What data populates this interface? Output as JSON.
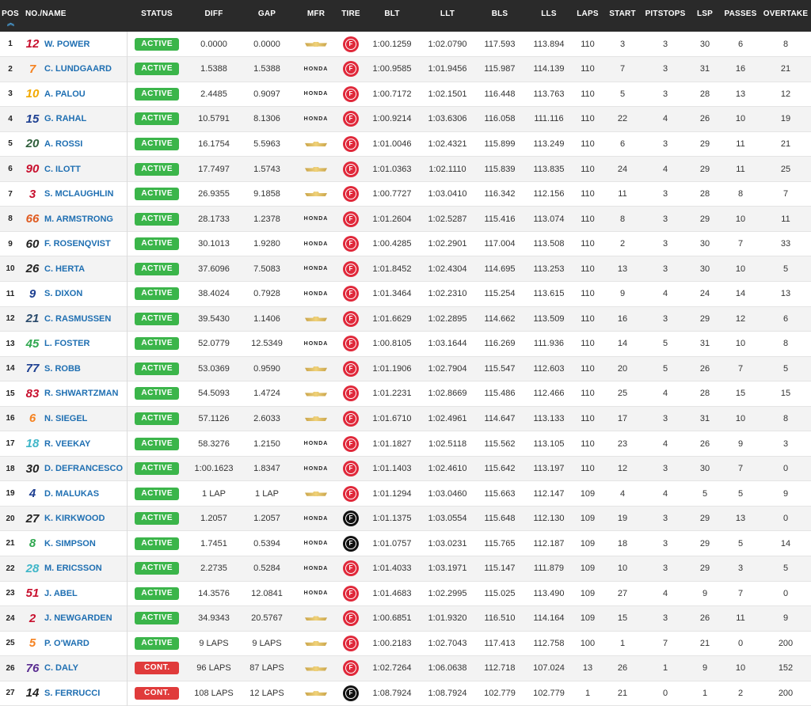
{
  "headers": {
    "pos": "POS",
    "name": "NO./NAME",
    "status": "STATUS",
    "diff": "DIFF",
    "gap": "GAP",
    "mfr": "MFR",
    "tire": "TIRE",
    "blt": "BLT",
    "llt": "LLT",
    "bls": "BLS",
    "lls": "LLS",
    "laps": "LAPS",
    "start": "START",
    "pitstops": "PITSTOPS",
    "lsp": "LSP",
    "passes": "PASSES",
    "overtake": "OVERTAKE"
  },
  "honda_label": "HONDA",
  "rows": [
    {
      "pos": "1",
      "num": "12",
      "num_color": "#c8102e",
      "name": "W. POWER",
      "status": "ACTIVE",
      "diff": "0.0000",
      "gap": "0.0000",
      "mfr": "chevrolet",
      "tire": "red",
      "blt": "1:00.1259",
      "llt": "1:02.0790",
      "bls": "117.593",
      "lls": "113.894",
      "laps": "110",
      "start": "3",
      "pitstops": "3",
      "lsp": "30",
      "passes": "6",
      "overtake": "8"
    },
    {
      "pos": "2",
      "num": "7",
      "num_color": "#f58220",
      "name": "C. LUNDGAARD",
      "status": "ACTIVE",
      "diff": "1.5388",
      "gap": "1.5388",
      "mfr": "honda",
      "tire": "red",
      "blt": "1:00.9585",
      "llt": "1:01.9456",
      "bls": "115.987",
      "lls": "114.139",
      "laps": "110",
      "start": "7",
      "pitstops": "3",
      "lsp": "31",
      "passes": "16",
      "overtake": "21"
    },
    {
      "pos": "3",
      "num": "10",
      "num_color": "#f2a900",
      "name": "A. PALOU",
      "status": "ACTIVE",
      "diff": "2.4485",
      "gap": "0.9097",
      "mfr": "honda",
      "tire": "red",
      "blt": "1:00.7172",
      "llt": "1:02.1501",
      "bls": "116.448",
      "lls": "113.763",
      "laps": "110",
      "start": "5",
      "pitstops": "3",
      "lsp": "28",
      "passes": "13",
      "overtake": "12"
    },
    {
      "pos": "4",
      "num": "15",
      "num_color": "#1d3f91",
      "name": "G. RAHAL",
      "status": "ACTIVE",
      "diff": "10.5791",
      "gap": "8.1306",
      "mfr": "honda",
      "tire": "red",
      "blt": "1:00.9214",
      "llt": "1:03.6306",
      "bls": "116.058",
      "lls": "111.116",
      "laps": "110",
      "start": "22",
      "pitstops": "4",
      "lsp": "26",
      "passes": "10",
      "overtake": "19"
    },
    {
      "pos": "5",
      "num": "20",
      "num_color": "#2e5e3a",
      "name": "A. ROSSI",
      "status": "ACTIVE",
      "diff": "16.1754",
      "gap": "5.5963",
      "mfr": "chevrolet",
      "tire": "red",
      "blt": "1:01.0046",
      "llt": "1:02.4321",
      "bls": "115.899",
      "lls": "113.249",
      "laps": "110",
      "start": "6",
      "pitstops": "3",
      "lsp": "29",
      "passes": "11",
      "overtake": "21"
    },
    {
      "pos": "6",
      "num": "90",
      "num_color": "#c8102e",
      "name": "C. ILOTT",
      "status": "ACTIVE",
      "diff": "17.7497",
      "gap": "1.5743",
      "mfr": "chevrolet",
      "tire": "red",
      "blt": "1:01.0363",
      "llt": "1:02.1110",
      "bls": "115.839",
      "lls": "113.835",
      "laps": "110",
      "start": "24",
      "pitstops": "4",
      "lsp": "29",
      "passes": "11",
      "overtake": "25"
    },
    {
      "pos": "7",
      "num": "3",
      "num_color": "#c8102e",
      "name": "S. MCLAUGHLIN",
      "status": "ACTIVE",
      "diff": "26.9355",
      "gap": "9.1858",
      "mfr": "chevrolet",
      "tire": "red",
      "blt": "1:00.7727",
      "llt": "1:03.0410",
      "bls": "116.342",
      "lls": "112.156",
      "laps": "110",
      "start": "11",
      "pitstops": "3",
      "lsp": "28",
      "passes": "8",
      "overtake": "7"
    },
    {
      "pos": "8",
      "num": "66",
      "num_color": "#e05a1f",
      "name": "M. ARMSTRONG",
      "status": "ACTIVE",
      "diff": "28.1733",
      "gap": "1.2378",
      "mfr": "honda",
      "tire": "red",
      "blt": "1:01.2604",
      "llt": "1:02.5287",
      "bls": "115.416",
      "lls": "113.074",
      "laps": "110",
      "start": "8",
      "pitstops": "3",
      "lsp": "29",
      "passes": "10",
      "overtake": "11"
    },
    {
      "pos": "9",
      "num": "60",
      "num_color": "#222222",
      "name": "F. ROSENQVIST",
      "status": "ACTIVE",
      "diff": "30.1013",
      "gap": "1.9280",
      "mfr": "honda",
      "tire": "red",
      "blt": "1:00.4285",
      "llt": "1:02.2901",
      "bls": "117.004",
      "lls": "113.508",
      "laps": "110",
      "start": "2",
      "pitstops": "3",
      "lsp": "30",
      "passes": "7",
      "overtake": "33"
    },
    {
      "pos": "10",
      "num": "26",
      "num_color": "#222222",
      "name": "C. HERTA",
      "status": "ACTIVE",
      "diff": "37.6096",
      "gap": "7.5083",
      "mfr": "honda",
      "tire": "red",
      "blt": "1:01.8452",
      "llt": "1:02.4304",
      "bls": "114.695",
      "lls": "113.253",
      "laps": "110",
      "start": "13",
      "pitstops": "3",
      "lsp": "30",
      "passes": "10",
      "overtake": "5"
    },
    {
      "pos": "11",
      "num": "9",
      "num_color": "#1d3f91",
      "name": "S. DIXON",
      "status": "ACTIVE",
      "diff": "38.4024",
      "gap": "0.7928",
      "mfr": "honda",
      "tire": "red",
      "blt": "1:01.3464",
      "llt": "1:02.2310",
      "bls": "115.254",
      "lls": "113.615",
      "laps": "110",
      "start": "9",
      "pitstops": "4",
      "lsp": "24",
      "passes": "14",
      "overtake": "13"
    },
    {
      "pos": "12",
      "num": "21",
      "num_color": "#2a4a6b",
      "name": "C. RASMUSSEN",
      "status": "ACTIVE",
      "diff": "39.5430",
      "gap": "1.1406",
      "mfr": "chevrolet",
      "tire": "red",
      "blt": "1:01.6629",
      "llt": "1:02.2895",
      "bls": "114.662",
      "lls": "113.509",
      "laps": "110",
      "start": "16",
      "pitstops": "3",
      "lsp": "29",
      "passes": "12",
      "overtake": "6"
    },
    {
      "pos": "13",
      "num": "45",
      "num_color": "#2fa84f",
      "name": "L. FOSTER",
      "status": "ACTIVE",
      "diff": "52.0779",
      "gap": "12.5349",
      "mfr": "honda",
      "tire": "red",
      "blt": "1:00.8105",
      "llt": "1:03.1644",
      "bls": "116.269",
      "lls": "111.936",
      "laps": "110",
      "start": "14",
      "pitstops": "5",
      "lsp": "31",
      "passes": "10",
      "overtake": "8"
    },
    {
      "pos": "14",
      "num": "77",
      "num_color": "#1d3f91",
      "name": "S. ROBB",
      "status": "ACTIVE",
      "diff": "53.0369",
      "gap": "0.9590",
      "mfr": "chevrolet",
      "tire": "red",
      "blt": "1:01.1906",
      "llt": "1:02.7904",
      "bls": "115.547",
      "lls": "112.603",
      "laps": "110",
      "start": "20",
      "pitstops": "5",
      "lsp": "26",
      "passes": "7",
      "overtake": "5"
    },
    {
      "pos": "15",
      "num": "83",
      "num_color": "#c8102e",
      "name": "R. SHWARTZMAN",
      "status": "ACTIVE",
      "diff": "54.5093",
      "gap": "1.4724",
      "mfr": "chevrolet",
      "tire": "red",
      "blt": "1:01.2231",
      "llt": "1:02.8669",
      "bls": "115.486",
      "lls": "112.466",
      "laps": "110",
      "start": "25",
      "pitstops": "4",
      "lsp": "28",
      "passes": "15",
      "overtake": "15"
    },
    {
      "pos": "16",
      "num": "6",
      "num_color": "#f58220",
      "name": "N. SIEGEL",
      "status": "ACTIVE",
      "diff": "57.1126",
      "gap": "2.6033",
      "mfr": "chevrolet",
      "tire": "red",
      "blt": "1:01.6710",
      "llt": "1:02.4961",
      "bls": "114.647",
      "lls": "113.133",
      "laps": "110",
      "start": "17",
      "pitstops": "3",
      "lsp": "31",
      "passes": "10",
      "overtake": "8"
    },
    {
      "pos": "17",
      "num": "18",
      "num_color": "#3fb6c8",
      "name": "R. VEEKAY",
      "status": "ACTIVE",
      "diff": "58.3276",
      "gap": "1.2150",
      "mfr": "honda",
      "tire": "red",
      "blt": "1:01.1827",
      "llt": "1:02.5118",
      "bls": "115.562",
      "lls": "113.105",
      "laps": "110",
      "start": "23",
      "pitstops": "4",
      "lsp": "26",
      "passes": "9",
      "overtake": "3"
    },
    {
      "pos": "18",
      "num": "30",
      "num_color": "#222222",
      "name": "D. DEFRANCESCO",
      "status": "ACTIVE",
      "diff": "1:00.1623",
      "gap": "1.8347",
      "mfr": "honda",
      "tire": "red",
      "blt": "1:01.1403",
      "llt": "1:02.4610",
      "bls": "115.642",
      "lls": "113.197",
      "laps": "110",
      "start": "12",
      "pitstops": "3",
      "lsp": "30",
      "passes": "7",
      "overtake": "0"
    },
    {
      "pos": "19",
      "num": "4",
      "num_color": "#1d3f91",
      "name": "D. MALUKAS",
      "status": "ACTIVE",
      "diff": "1 LAP",
      "gap": "1 LAP",
      "mfr": "chevrolet",
      "tire": "red",
      "blt": "1:01.1294",
      "llt": "1:03.0460",
      "bls": "115.663",
      "lls": "112.147",
      "laps": "109",
      "start": "4",
      "pitstops": "4",
      "lsp": "5",
      "passes": "5",
      "overtake": "9"
    },
    {
      "pos": "20",
      "num": "27",
      "num_color": "#222222",
      "name": "K. KIRKWOOD",
      "status": "ACTIVE",
      "diff": "1.2057",
      "gap": "1.2057",
      "mfr": "honda",
      "tire": "black",
      "blt": "1:01.1375",
      "llt": "1:03.0554",
      "bls": "115.648",
      "lls": "112.130",
      "laps": "109",
      "start": "19",
      "pitstops": "3",
      "lsp": "29",
      "passes": "13",
      "overtake": "0"
    },
    {
      "pos": "21",
      "num": "8",
      "num_color": "#2fa84f",
      "name": "K. SIMPSON",
      "status": "ACTIVE",
      "diff": "1.7451",
      "gap": "0.5394",
      "mfr": "honda",
      "tire": "black",
      "blt": "1:01.0757",
      "llt": "1:03.0231",
      "bls": "115.765",
      "lls": "112.187",
      "laps": "109",
      "start": "18",
      "pitstops": "3",
      "lsp": "29",
      "passes": "5",
      "overtake": "14"
    },
    {
      "pos": "22",
      "num": "28",
      "num_color": "#3fb6c8",
      "name": "M. ERICSSON",
      "status": "ACTIVE",
      "diff": "2.2735",
      "gap": "0.5284",
      "mfr": "honda",
      "tire": "red",
      "blt": "1:01.4033",
      "llt": "1:03.1971",
      "bls": "115.147",
      "lls": "111.879",
      "laps": "109",
      "start": "10",
      "pitstops": "3",
      "lsp": "29",
      "passes": "3",
      "overtake": "5"
    },
    {
      "pos": "23",
      "num": "51",
      "num_color": "#c8102e",
      "name": "J. ABEL",
      "status": "ACTIVE",
      "diff": "14.3576",
      "gap": "12.0841",
      "mfr": "honda",
      "tire": "red",
      "blt": "1:01.4683",
      "llt": "1:02.2995",
      "bls": "115.025",
      "lls": "113.490",
      "laps": "109",
      "start": "27",
      "pitstops": "4",
      "lsp": "9",
      "passes": "7",
      "overtake": "0"
    },
    {
      "pos": "24",
      "num": "2",
      "num_color": "#c8102e",
      "name": "J. NEWGARDEN",
      "status": "ACTIVE",
      "diff": "34.9343",
      "gap": "20.5767",
      "mfr": "chevrolet",
      "tire": "red",
      "blt": "1:00.6851",
      "llt": "1:01.9320",
      "bls": "116.510",
      "lls": "114.164",
      "laps": "109",
      "start": "15",
      "pitstops": "3",
      "lsp": "26",
      "passes": "11",
      "overtake": "9"
    },
    {
      "pos": "25",
      "num": "5",
      "num_color": "#f58220",
      "name": "P. O'WARD",
      "status": "ACTIVE",
      "diff": "9 LAPS",
      "gap": "9 LAPS",
      "mfr": "chevrolet",
      "tire": "red",
      "blt": "1:00.2183",
      "llt": "1:02.7043",
      "bls": "117.413",
      "lls": "112.758",
      "laps": "100",
      "start": "1",
      "pitstops": "7",
      "lsp": "21",
      "passes": "0",
      "overtake": "200"
    },
    {
      "pos": "26",
      "num": "76",
      "num_color": "#5a2d91",
      "name": "C. DALY",
      "status": "CONT.",
      "diff": "96 LAPS",
      "gap": "87 LAPS",
      "mfr": "chevrolet",
      "tire": "red",
      "blt": "1:02.7264",
      "llt": "1:06.0638",
      "bls": "112.718",
      "lls": "107.024",
      "laps": "13",
      "start": "26",
      "pitstops": "1",
      "lsp": "9",
      "passes": "10",
      "overtake": "152"
    },
    {
      "pos": "27",
      "num": "14",
      "num_color": "#222222",
      "name": "S. FERRUCCI",
      "status": "CONT.",
      "diff": "108 LAPS",
      "gap": "12 LAPS",
      "mfr": "chevrolet",
      "tire": "black",
      "blt": "1:08.7924",
      "llt": "1:08.7924",
      "bls": "102.779",
      "lls": "102.779",
      "laps": "1",
      "start": "21",
      "pitstops": "0",
      "lsp": "1",
      "passes": "2",
      "overtake": "200"
    }
  ]
}
